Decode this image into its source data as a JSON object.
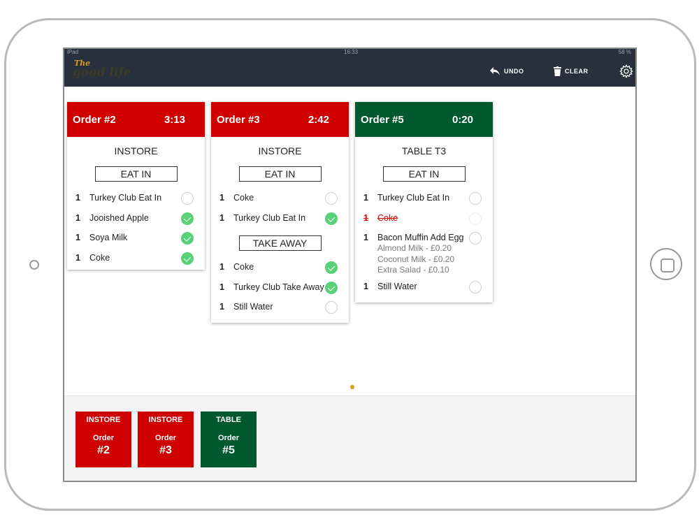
{
  "statusbar": {
    "left": "iPad",
    "time": "16:33",
    "right": "58 %"
  },
  "brand": {
    "the": "The",
    "main": "good life"
  },
  "toolbar": {
    "undo_label": "UNDO",
    "clear_label": "CLEAR"
  },
  "colors": {
    "red": "#cf0000",
    "green": "#00592c",
    "check": "#5ad179",
    "topbar": "#27303c",
    "accent": "#d4a017"
  },
  "tickets": [
    {
      "title": "Order #2",
      "timer": "3:13",
      "color": "red",
      "type": "INSTORE",
      "sections": [
        {
          "label": "EAT IN",
          "items": [
            {
              "qty": "1",
              "name": "Turkey Club Eat In",
              "done": false
            },
            {
              "qty": "1",
              "name": "Jooished Apple",
              "done": true
            },
            {
              "qty": "1",
              "name": "Soya Milk",
              "done": true
            },
            {
              "qty": "1",
              "name": "Coke",
              "done": true
            }
          ]
        }
      ]
    },
    {
      "title": "Order #3",
      "timer": "2:42",
      "color": "red",
      "type": "INSTORE",
      "sections": [
        {
          "label": "EAT IN",
          "items": [
            {
              "qty": "1",
              "name": "Coke",
              "done": false
            },
            {
              "qty": "1",
              "name": "Turkey Club Eat In",
              "done": true
            }
          ]
        },
        {
          "label": "TAKE AWAY",
          "items": [
            {
              "qty": "1",
              "name": "Coke",
              "done": true
            },
            {
              "qty": "1",
              "name": "Turkey Club Take Away",
              "done": true
            },
            {
              "qty": "1",
              "name": "Still Water",
              "done": false
            }
          ]
        }
      ]
    },
    {
      "title": "Order #5",
      "timer": "0:20",
      "color": "green",
      "type": "TABLE T3",
      "sections": [
        {
          "label": "EAT IN",
          "items": [
            {
              "qty": "1",
              "name": "Turkey Club Eat In",
              "done": false
            },
            {
              "qty": "1",
              "name": "Coke",
              "done": false,
              "voided": true
            },
            {
              "qty": "1",
              "name": "Bacon Muffin Add Egg",
              "done": false,
              "mods": [
                "Almond Milk - £0.20",
                "Coconut Milk - £0.20",
                "Extra Salad - £0.10"
              ]
            },
            {
              "qty": "1",
              "name": "Still Water",
              "done": false
            }
          ]
        }
      ]
    }
  ],
  "tray": [
    {
      "type": "INSTORE",
      "order_word": "Order",
      "number": "#2",
      "color": "red"
    },
    {
      "type": "INSTORE",
      "order_word": "Order",
      "number": "#3",
      "color": "red"
    },
    {
      "type": "TABLE",
      "order_word": "Order",
      "number": "#5",
      "color": "green"
    }
  ]
}
